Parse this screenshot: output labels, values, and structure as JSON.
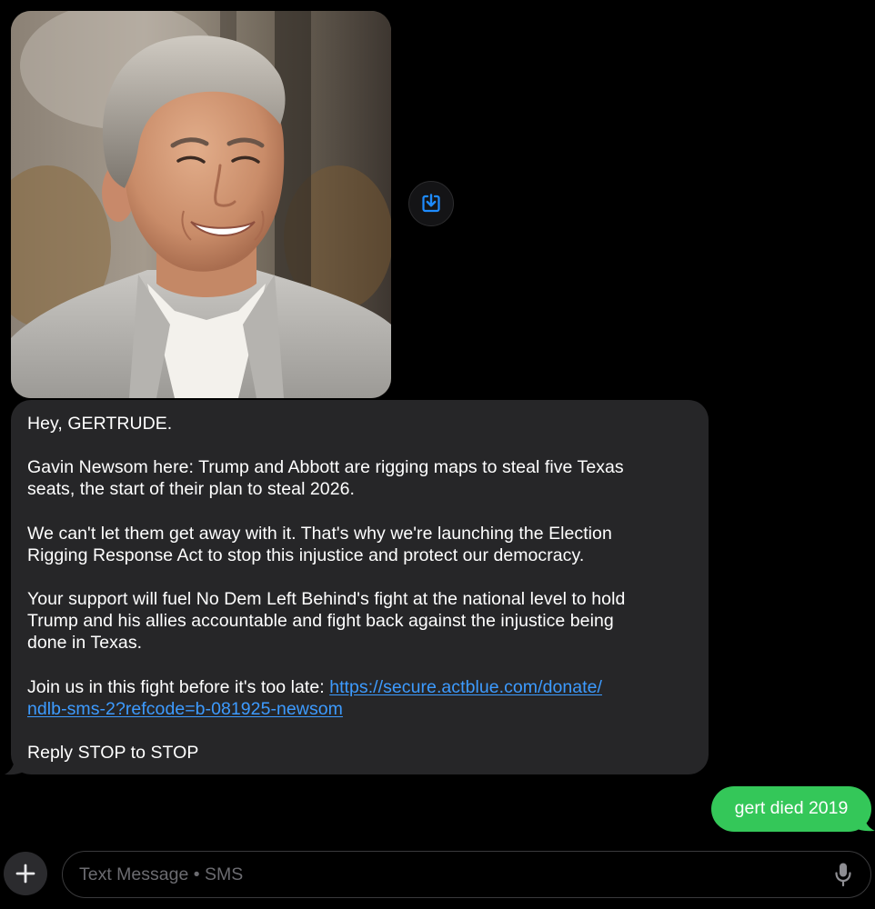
{
  "thread": {
    "incoming": {
      "paragraphs": [
        "Hey, GERTRUDE.",
        "Gavin Newsom here: Trump and Abbott are rigging maps to steal five Texas\nseats, the start of their plan to steal 2026.",
        "We can't let them get away with it. That's why we're launching the Election\nRigging Response Act to stop this injustice and protect our democracy.",
        "Your support will fuel No Dem Left Behind's fight at the national level to hold\nTrump and his allies accountable and fight back against the injustice being\ndone in Texas."
      ],
      "cta_text": "Join us in this fight before it's too late: ",
      "link_line_1": "https://secure.actblue.com/donate/",
      "link_line_2": "ndlb-sms-2?refcode=b-081925-newsom",
      "reply_line": "Reply STOP to STOP"
    },
    "outgoing": {
      "text": "gert died 2019"
    },
    "attachment": {
      "save_icon": "save-to-photos-icon"
    }
  },
  "compose": {
    "placeholder": "Text Message • SMS",
    "value": "",
    "plus_icon": "plus-icon",
    "mic_icon": "microphone-icon"
  },
  "colors": {
    "background": "#000000",
    "incoming_bubble": "#262628",
    "outgoing_bubble": "#34c759",
    "link": "#3d9bff",
    "placeholder": "#6b6b70"
  }
}
